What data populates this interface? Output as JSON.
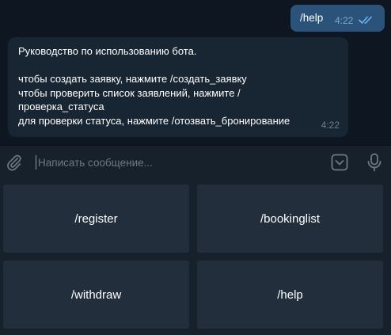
{
  "messages": {
    "outgoing": {
      "text": "/help",
      "time": "4:22"
    },
    "incoming": {
      "lines": [
        "Руководство по использованию бота.",
        "",
        "чтобы создать заявку, нажмите /создать_заявку",
        "чтобы проверить список заявлений, нажмите  /",
        "проверка_статуса",
        "для проверки статуса, нажмите /отозвать_бронирование"
      ],
      "time": "4:22"
    }
  },
  "composer": {
    "placeholder": "Написать сообщение..."
  },
  "keyboard": {
    "buttons": [
      "/register",
      "/bookinglist",
      "/withdraw",
      "/help"
    ]
  },
  "icons": {
    "attach": "paperclip-icon",
    "keyboard": "keyboard-toggle-icon",
    "mic": "microphone-icon",
    "read": "double-check-icon"
  },
  "colors": {
    "background": "#0e1621",
    "outgoing_bubble": "#2b5278",
    "incoming_bubble": "#182533",
    "panel": "#17212b",
    "button": "#232e3c"
  }
}
